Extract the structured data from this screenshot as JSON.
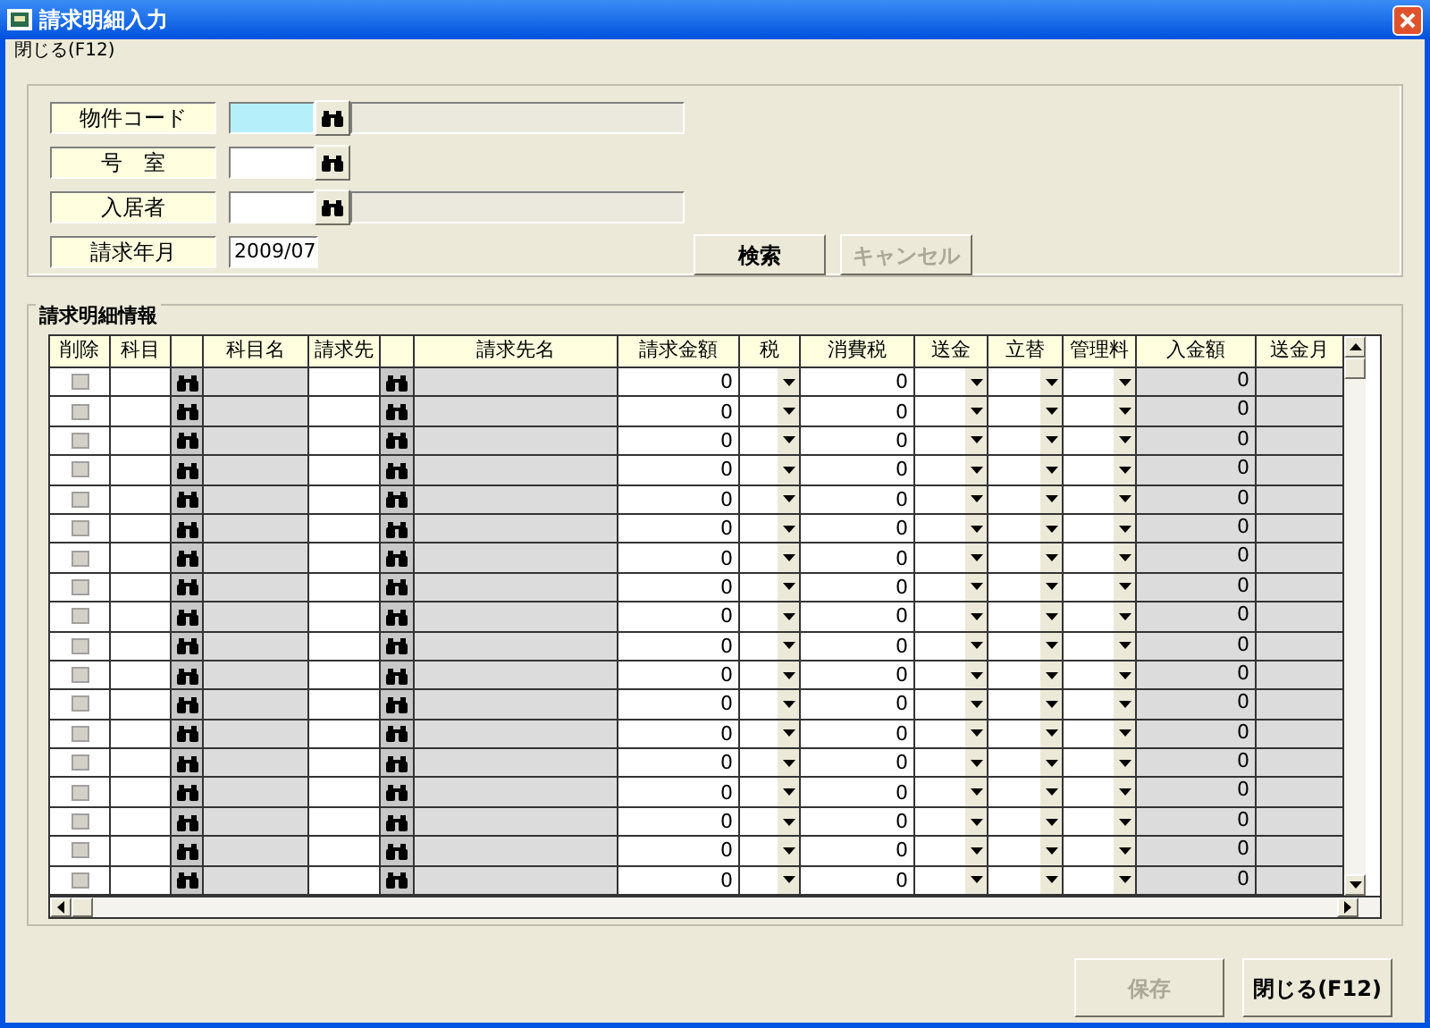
{
  "window": {
    "title": "請求明細入力"
  },
  "menu": [
    {
      "label": "閉じる(F12)"
    }
  ],
  "search_form": {
    "fields": [
      {
        "label": "物件コード",
        "kind": "lookup_name",
        "focused": true
      },
      {
        "label": "号　室",
        "kind": "lookup",
        "focused": false
      },
      {
        "label": "入居者",
        "kind": "lookup_name",
        "focused": false
      },
      {
        "label": "請求年月",
        "kind": "text",
        "focused": false,
        "value": "2009/07"
      }
    ],
    "buttons": [
      {
        "label": "検索",
        "disabled": false
      },
      {
        "label": "キャンセル",
        "disabled": true
      }
    ]
  },
  "details": {
    "title": "請求明細情報",
    "columns": [
      {
        "label": "削除",
        "kind": "check"
      },
      {
        "label": "科目",
        "kind": "input"
      },
      {
        "kind": "lookup"
      },
      {
        "label": "科目名",
        "kind": "readonly"
      },
      {
        "label": "請求先",
        "kind": "input"
      },
      {
        "kind": "lookup"
      },
      {
        "label": "請求先名",
        "kind": "readonly"
      },
      {
        "label": "請求金額",
        "kind": "amount"
      },
      {
        "label": "税",
        "kind": "dropdown"
      },
      {
        "label": "消費税",
        "kind": "amount"
      },
      {
        "label": "送金",
        "kind": "dropdown"
      },
      {
        "label": "立替",
        "kind": "dropdown"
      },
      {
        "label": "管理料",
        "kind": "dropdown"
      },
      {
        "label": "入金額",
        "kind": "readonly_amount"
      },
      {
        "label": "送金月",
        "kind": "readonly"
      }
    ],
    "rows": [
      {
        "checked": false,
        "amounts": [
          "0",
          "0",
          "0"
        ]
      },
      {
        "checked": false,
        "amounts": [
          "0",
          "0",
          "0"
        ]
      },
      {
        "checked": false,
        "amounts": [
          "0",
          "0",
          "0"
        ]
      },
      {
        "checked": false,
        "amounts": [
          "0",
          "0",
          "0"
        ]
      },
      {
        "checked": false,
        "amounts": [
          "0",
          "0",
          "0"
        ]
      },
      {
        "checked": false,
        "amounts": [
          "0",
          "0",
          "0"
        ]
      },
      {
        "checked": false,
        "amounts": [
          "0",
          "0",
          "0"
        ]
      },
      {
        "checked": false,
        "amounts": [
          "0",
          "0",
          "0"
        ]
      },
      {
        "checked": false,
        "amounts": [
          "0",
          "0",
          "0"
        ]
      },
      {
        "checked": false,
        "amounts": [
          "0",
          "0",
          "0"
        ]
      },
      {
        "checked": false,
        "amounts": [
          "0",
          "0",
          "0"
        ]
      },
      {
        "checked": false,
        "amounts": [
          "0",
          "0",
          "0"
        ]
      },
      {
        "checked": false,
        "amounts": [
          "0",
          "0",
          "0"
        ]
      },
      {
        "checked": false,
        "amounts": [
          "0",
          "0",
          "0"
        ]
      },
      {
        "checked": false,
        "amounts": [
          "0",
          "0",
          "0"
        ]
      },
      {
        "checked": false,
        "amounts": [
          "0",
          "0",
          "0"
        ]
      },
      {
        "checked": false,
        "amounts": [
          "0",
          "0",
          "0"
        ]
      },
      {
        "checked": false,
        "amounts": [
          "0",
          "0",
          "0"
        ]
      }
    ]
  },
  "footer_buttons": [
    {
      "label": "保存",
      "disabled": true
    },
    {
      "label": "閉じる(F12)",
      "disabled": false
    }
  ]
}
